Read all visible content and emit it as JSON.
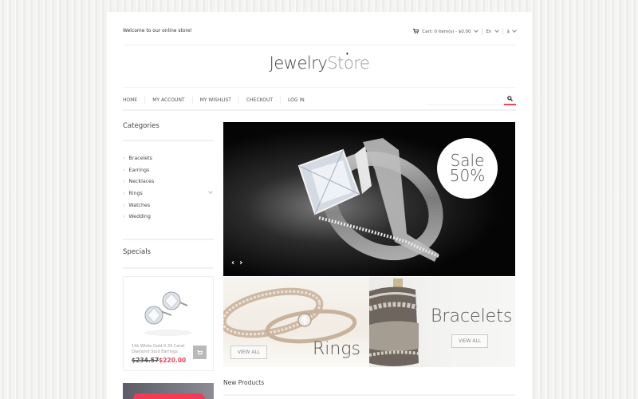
{
  "topbar": {
    "welcome": "Welcome to our online store!",
    "cart": "Cart: 0 item(s) - $0.00",
    "language": "En",
    "currency": "$"
  },
  "logo": {
    "part1": "Jewelry",
    "part2": "St",
    "ring_letter": "o",
    "part3": "re"
  },
  "nav": {
    "items": [
      "HOME",
      "MY ACCOUNT",
      "MY WISHLIST",
      "CHECKOUT",
      "LOG IN"
    ],
    "search_placeholder": ""
  },
  "sidebar": {
    "categories_title": "Categories",
    "categories": [
      "Bracelets",
      "Earrings",
      "Necklaces",
      "Rings",
      "Watches",
      "Wedding"
    ],
    "specials_title": "Specials",
    "special_product": {
      "name": "14k White Gold 0.33 Carat Diamond Stud Earrings",
      "old_price": "$234.57",
      "new_price": "$220.00"
    }
  },
  "hero": {
    "sale_line1": "Sale",
    "sale_line2": "50%",
    "prev": "‹",
    "next": "›"
  },
  "banners": {
    "rings": {
      "label": "Rings",
      "button": "VIEW ALL"
    },
    "bracelets": {
      "label": "Bracelets",
      "button": "VIEW ALL"
    }
  },
  "sections": {
    "new_products": "New Products"
  },
  "colors": {
    "accent": "#e84a5a",
    "promo_button": "#f23c57"
  }
}
